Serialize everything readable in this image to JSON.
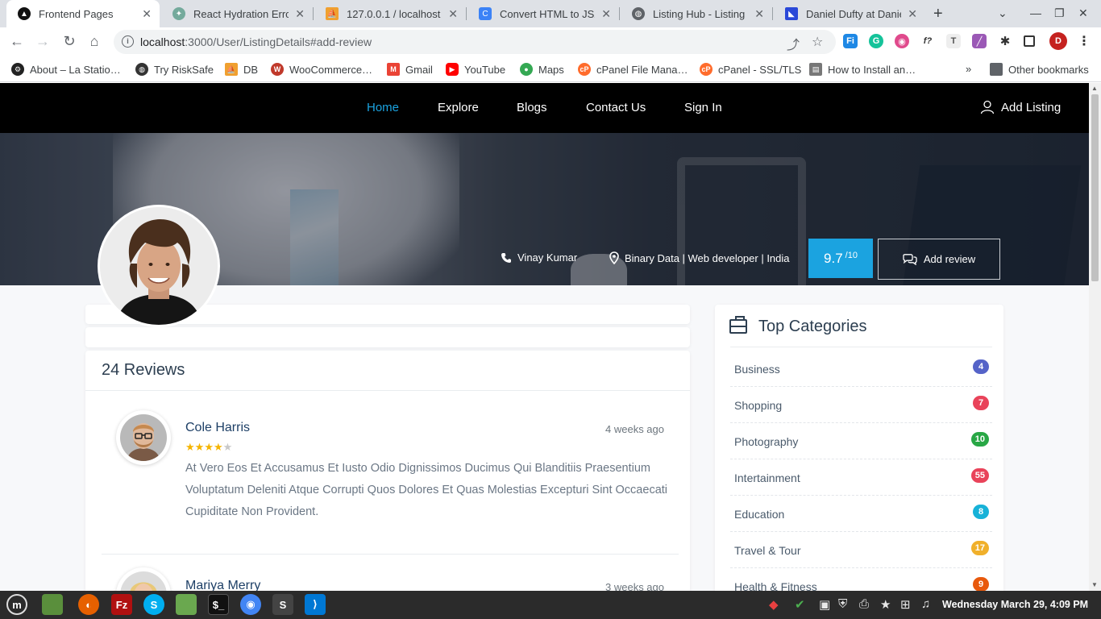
{
  "browser": {
    "tabs": [
      {
        "title": "Frontend Pages",
        "active": true
      },
      {
        "title": "React Hydration Error",
        "active": false
      },
      {
        "title": "127.0.0.1 / localhost /",
        "active": false
      },
      {
        "title": "Convert HTML to JSX",
        "active": false
      },
      {
        "title": "Listing Hub - Listing &",
        "active": false
      },
      {
        "title": "Daniel Dufty at Daniel",
        "active": false
      }
    ],
    "url_host": "localhost",
    "url_rest": ":3000/User/ListingDetails#add-review",
    "profile_initial": "D",
    "bookmarks": [
      "About – La Statio…",
      "Try RiskSafe",
      "DB",
      "WooCommerce…",
      "Gmail",
      "YouTube",
      "Maps",
      "cPanel File Mana…",
      "cPanel - SSL/TLS",
      "How to Install an…"
    ],
    "other_bookmarks": "Other bookmarks",
    "overflow": "»"
  },
  "site": {
    "nav": [
      "Home",
      "Explore",
      "Blogs",
      "Contact Us",
      "Sign In"
    ],
    "add_listing": "Add Listing",
    "owner_name": "Vinay Kumar",
    "location": "Binary Data | Web developer | India",
    "rating": "9.7",
    "rating_max": "/10",
    "add_review": "Add review"
  },
  "reviews": {
    "title": "24 Reviews",
    "items": [
      {
        "name": "Cole Harris",
        "time": "4 weeks ago",
        "rating": 4,
        "text": "At Vero Eos Et Accusamus Et Iusto Odio Dignissimos Ducimus Qui Blanditiis Praesentium Voluptatum Deleniti Atque Corrupti Quos Dolores Et Quas Molestias Excepturi Sint Occaecati Cupiditate Non Provident."
      },
      {
        "name": "Mariya Merry",
        "time": "3 weeks ago"
      }
    ]
  },
  "sidebar": {
    "title": "Top Categories",
    "categories": [
      {
        "name": "Business",
        "count": "4",
        "color": "#5563c8"
      },
      {
        "name": "Shopping",
        "count": "7",
        "color": "#e9435a"
      },
      {
        "name": "Photography",
        "count": "10",
        "color": "#28a745"
      },
      {
        "name": "Intertainment",
        "count": "55",
        "color": "#e9435a"
      },
      {
        "name": "Education",
        "count": "8",
        "color": "#17b2d8"
      },
      {
        "name": "Travel & Tour",
        "count": "17",
        "color": "#f0b02b"
      },
      {
        "name": "Health & Fitness",
        "count": "9",
        "color": "#e8590c"
      }
    ]
  },
  "taskbar": {
    "clock": "Wednesday March 29, 4:09 PM"
  }
}
